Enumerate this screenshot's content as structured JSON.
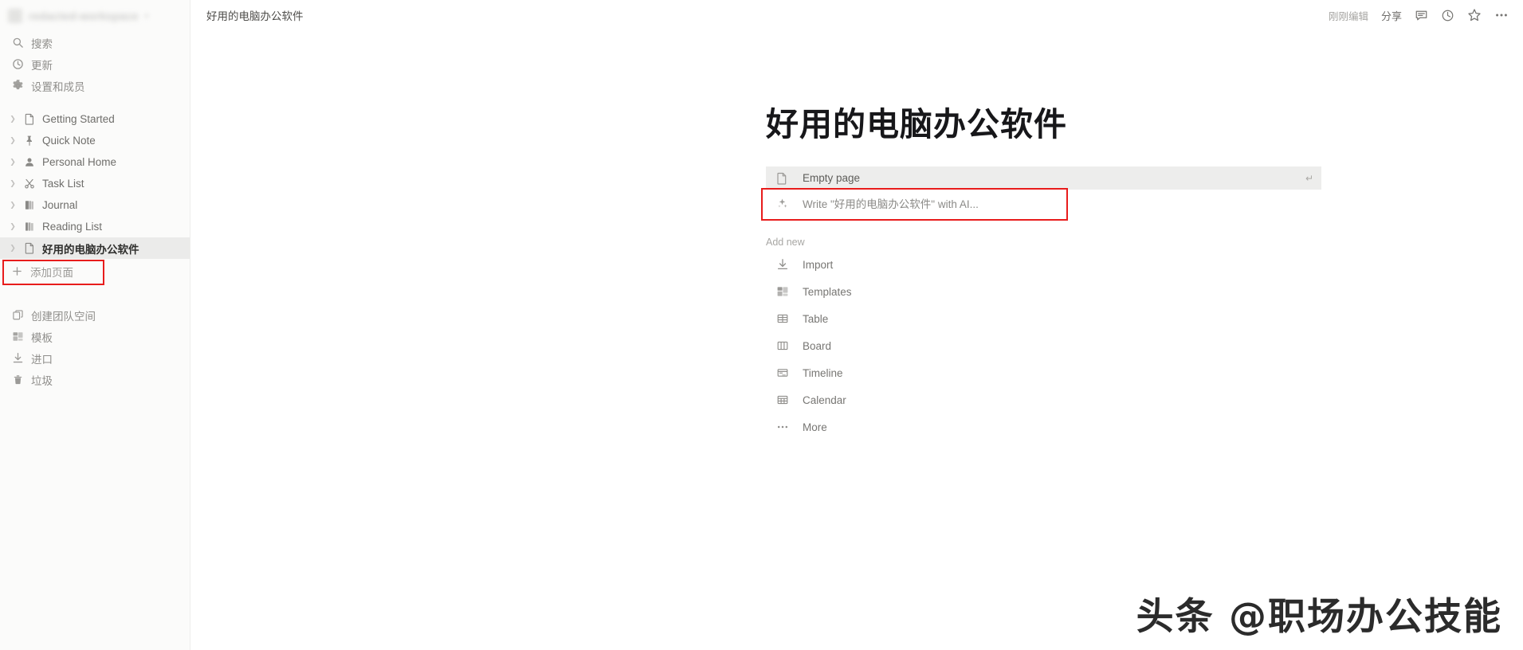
{
  "sidebar": {
    "workspace": {
      "name": "redacted-workspace",
      "chevron": "chevron-down-icon"
    },
    "quick_items": [
      {
        "label": "搜索",
        "icon": "search-icon"
      },
      {
        "label": "更新",
        "icon": "clock-icon"
      },
      {
        "label": "设置和成员",
        "icon": "gear-icon"
      }
    ],
    "pages": [
      {
        "label": "Getting Started",
        "icon": "page-icon",
        "selected": false
      },
      {
        "label": "Quick Note",
        "icon": "pin-icon",
        "selected": false
      },
      {
        "label": "Personal Home",
        "icon": "person-icon",
        "selected": false
      },
      {
        "label": "Task List",
        "icon": "scissors-icon",
        "selected": false
      },
      {
        "label": "Journal",
        "icon": "book-icon",
        "selected": false
      },
      {
        "label": "Reading List",
        "icon": "books-icon",
        "selected": false
      },
      {
        "label": "好用的电脑办公软件",
        "icon": "page-icon",
        "selected": true
      }
    ],
    "add_page": {
      "label": "添加页面",
      "icon": "plus-icon",
      "highlight_color": "#e81c1c"
    },
    "bottom_items": [
      {
        "label": "创建团队空间",
        "icon": "teamspace-icon"
      },
      {
        "label": "模板",
        "icon": "templates-icon"
      },
      {
        "label": "进口",
        "icon": "import-icon"
      },
      {
        "label": "垃圾",
        "icon": "trash-icon"
      }
    ]
  },
  "topbar": {
    "breadcrumb": "好用的电脑办公软件",
    "edited_status": "刚刚编辑",
    "share_label": "分享",
    "icons": [
      {
        "name": "comment-icon"
      },
      {
        "name": "history-clock-icon"
      },
      {
        "name": "star-icon"
      },
      {
        "name": "more-horizontal-icon"
      }
    ]
  },
  "main": {
    "page_title": "好用的电脑办公软件",
    "suggestions": [
      {
        "label": "Empty page",
        "icon": "page-icon",
        "highlighted": true,
        "enter_key": "↵"
      },
      {
        "label": "Write \"好用的电脑办公软件\" with AI...",
        "icon": "ai-sparkle-icon",
        "highlighted": false,
        "redbox": true
      }
    ],
    "add_new_label": "Add new",
    "add_new_items": [
      {
        "label": "Import",
        "icon": "import-download-icon"
      },
      {
        "label": "Templates",
        "icon": "templates-icon"
      },
      {
        "label": "Table",
        "icon": "table-grid-icon"
      },
      {
        "label": "Board",
        "icon": "board-columns-icon"
      },
      {
        "label": "Timeline",
        "icon": "timeline-icon"
      },
      {
        "label": "Calendar",
        "icon": "calendar-icon"
      },
      {
        "label": "More",
        "icon": "more-horizontal-icon"
      }
    ]
  },
  "watermark": {
    "text": "头条 @职场办公技能"
  },
  "colors": {
    "accent_red": "#e81c1c",
    "sidebar_bg": "#fbfbfa",
    "highlight_bg": "#ededec",
    "ai_purple": "#8b6fd0"
  }
}
